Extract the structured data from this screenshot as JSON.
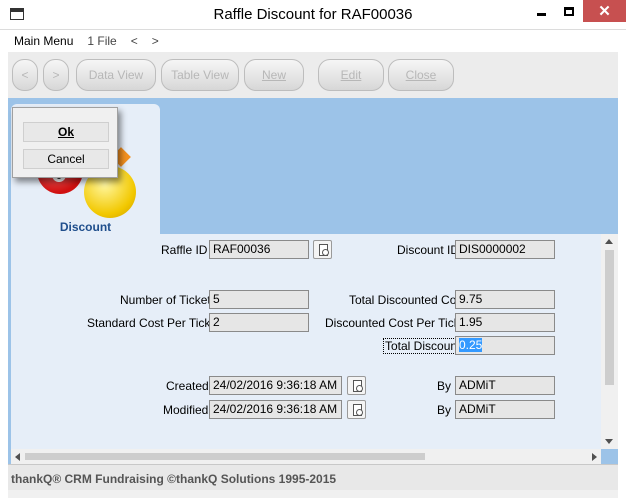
{
  "window": {
    "title": "Raffle Discount for RAF00036"
  },
  "menu": {
    "main": "Main Menu",
    "file_count": "1 File",
    "prev": "<",
    "next": ">"
  },
  "toolbar": {
    "back": "<",
    "forward": ">",
    "data_view": "Data View",
    "table_view": "Table View",
    "new": "New",
    "edit": "Edit",
    "close": "Close"
  },
  "popup": {
    "ok": "Ok",
    "cancel": "Cancel"
  },
  "tab": {
    "label": "Discount"
  },
  "form": {
    "raffle_id_label": "Raffle ID",
    "raffle_id": "RAF00036",
    "discount_id_label": "Discount ID",
    "discount_id": "DIS0000002",
    "num_tickets_label": "Number of Tickets",
    "num_tickets": "5",
    "std_cost_label": "Standard Cost Per Ticket",
    "std_cost": "2",
    "total_disc_cost_label": "Total Discounted Cost",
    "total_disc_cost": "9.75",
    "disc_cost_ticket_label": "Discounted Cost Per Ticket",
    "disc_cost_ticket": "1.95",
    "total_discount_label": "Total Discount",
    "total_discount": "0.25",
    "created_label": "Created",
    "created": "24/02/2016 9:36:18 AM",
    "created_by_label": "By",
    "created_by": "ADMiT",
    "modified_label": "Modified",
    "modified": "24/02/2016 9:36:18 AM",
    "modified_by_label": "By",
    "modified_by": "ADMiT"
  },
  "status": {
    "text": "thankQ® CRM Fundraising ©thankQ Solutions 1995-2015"
  }
}
